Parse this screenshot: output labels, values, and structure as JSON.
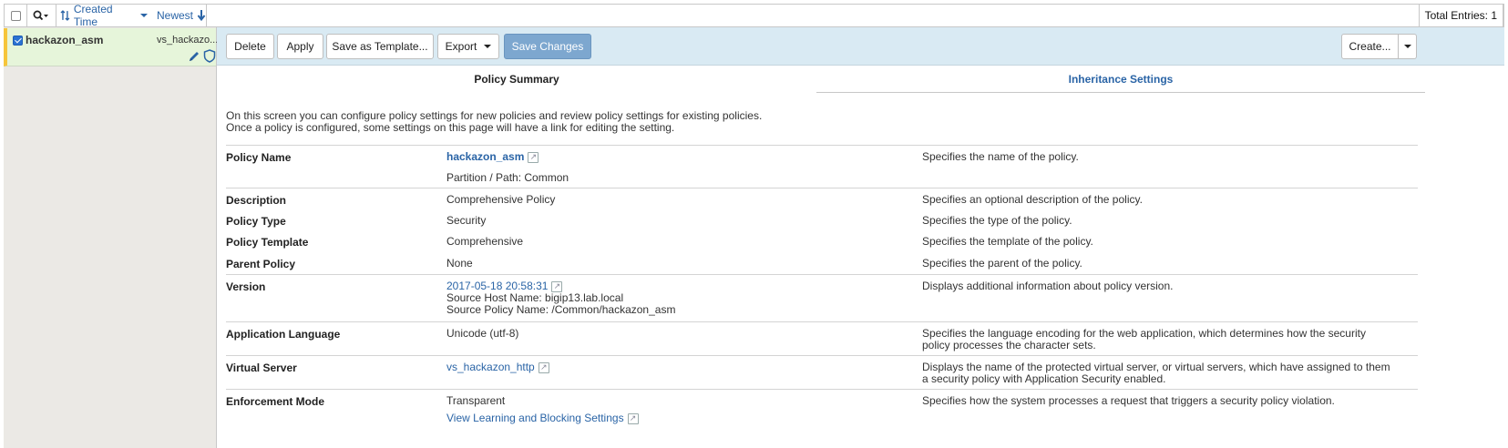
{
  "topbar": {
    "sort_created": "Created Time",
    "sort_newest": "Newest",
    "total_entries": "Total Entries: 1"
  },
  "list": {
    "items": [
      {
        "name": "hackazon_asm",
        "virtual_server": "vs_hackazo...",
        "checked": true
      }
    ]
  },
  "toolbar": {
    "delete_label": "Delete",
    "apply_label": "Apply",
    "save_template_label": "Save as Template...",
    "export_label": "Export",
    "save_changes_label": "Save Changes",
    "create_label": "Create..."
  },
  "tabs": [
    {
      "label": "Policy Summary",
      "active": true
    },
    {
      "label": "Inheritance Settings",
      "active": false
    }
  ],
  "intro": {
    "line1": "On this screen you can configure policy settings for new policies and review policy settings for existing policies.",
    "line2": "Once a policy is configured, some settings on this page will have a link for editing the setting."
  },
  "rows": {
    "policy_name": {
      "label": "Policy Name",
      "value": "hackazon_asm",
      "sub": "Partition / Path: Common",
      "desc": "Specifies the name of the policy."
    },
    "description": {
      "label": "Description",
      "value": "Comprehensive Policy",
      "desc": "Specifies an optional description of the policy."
    },
    "policy_type": {
      "label": "Policy Type",
      "value": "Security",
      "desc": "Specifies the type of the policy."
    },
    "policy_template": {
      "label": "Policy Template",
      "value": "Comprehensive",
      "desc": "Specifies the template of the policy."
    },
    "parent_policy": {
      "label": "Parent Policy",
      "value": "None",
      "desc": "Specifies the parent of the policy."
    },
    "version": {
      "label": "Version",
      "value": "2017-05-18 20:58:31",
      "host": "Source Host Name: bigip13.lab.local",
      "source_policy": "Source Policy Name: /Common/hackazon_asm",
      "desc": "Displays additional information about policy version."
    },
    "app_language": {
      "label": "Application Language",
      "value": "Unicode (utf-8)",
      "desc": "Specifies the language encoding for the web application, which determines how the security policy processes the character sets."
    },
    "virtual_server": {
      "label": "Virtual Server",
      "value": "vs_hackazon_http",
      "desc": "Displays the name of the protected virtual server, or virtual servers, which have assigned to them a security policy with Application Security enabled."
    },
    "enforcement_mode": {
      "label": "Enforcement Mode",
      "value": "Transparent",
      "link": "View Learning and Blocking Settings",
      "desc": "Specifies how the system processes a request that triggers a security policy violation."
    }
  }
}
